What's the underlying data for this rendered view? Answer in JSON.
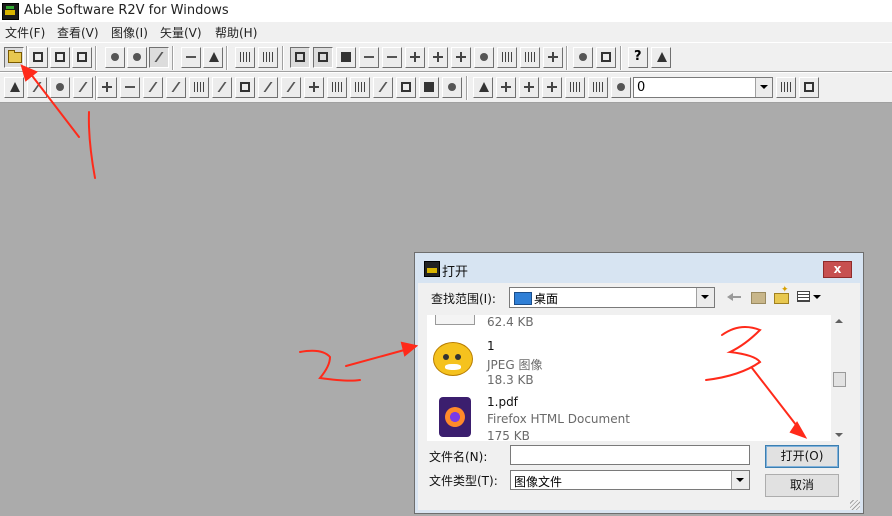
{
  "window": {
    "title": "Able Software R2V for Windows"
  },
  "menu": [
    "文件(F)",
    "查看(V)",
    "图像(I)",
    "矢量(V)",
    "帮助(H)"
  ],
  "combo": {
    "value": "0"
  },
  "dialog": {
    "title": "打开",
    "close_label": "x",
    "look_in_label": "查找范围(I):",
    "look_in_value": "桌面",
    "files": [
      {
        "name": "",
        "type": "",
        "size": "62.4 KB",
        "icon": "blank-file-icon"
      },
      {
        "name": "1",
        "type": "JPEG 图像",
        "size": "18.3 KB",
        "icon": "tiger-image-icon"
      },
      {
        "name": "1.pdf",
        "type": "Firefox HTML Document",
        "size": "175 KB",
        "icon": "firefox-document-icon"
      }
    ],
    "filename_label": "文件名(N):",
    "filename_value": "",
    "filetype_label": "文件类型(T):",
    "filetype_value": "图像文件",
    "open_button": "打开(O)",
    "cancel_button": "取消"
  },
  "colors": {
    "annotation": "#ff2a1a",
    "workspace": "#ababab",
    "dialog_title": "#d7e4f2"
  }
}
